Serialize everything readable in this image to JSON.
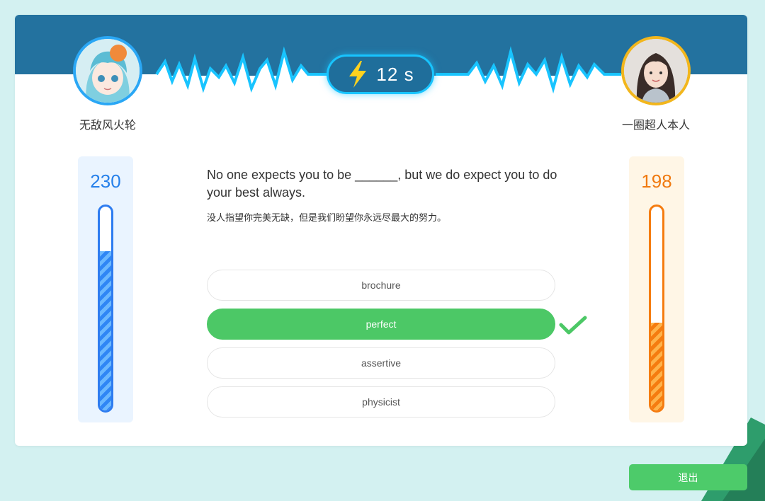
{
  "timer": {
    "value": "12 s",
    "icon": "lightning-icon"
  },
  "players": {
    "left": {
      "name": "无敌风火轮",
      "score": "230",
      "progress": 0.78,
      "color": "#2680ea"
    },
    "right": {
      "name": "一圈超人本人",
      "score": "198",
      "progress": 0.43,
      "color": "#f07a10"
    }
  },
  "question": {
    "text": "No one expects you to be ______, but we do expect you to do your best always.",
    "translation": "没人指望你完美无缺，但是我们盼望你永远尽最大的努力。"
  },
  "options": [
    {
      "label": "brochure",
      "selected": false
    },
    {
      "label": "perfect",
      "selected": true
    },
    {
      "label": "assertive",
      "selected": false
    },
    {
      "label": "physicist",
      "selected": false
    }
  ],
  "exit_label": "退出",
  "colors": {
    "header": "#23729f",
    "accent": "#18c4ff",
    "correct": "#4cc866"
  }
}
